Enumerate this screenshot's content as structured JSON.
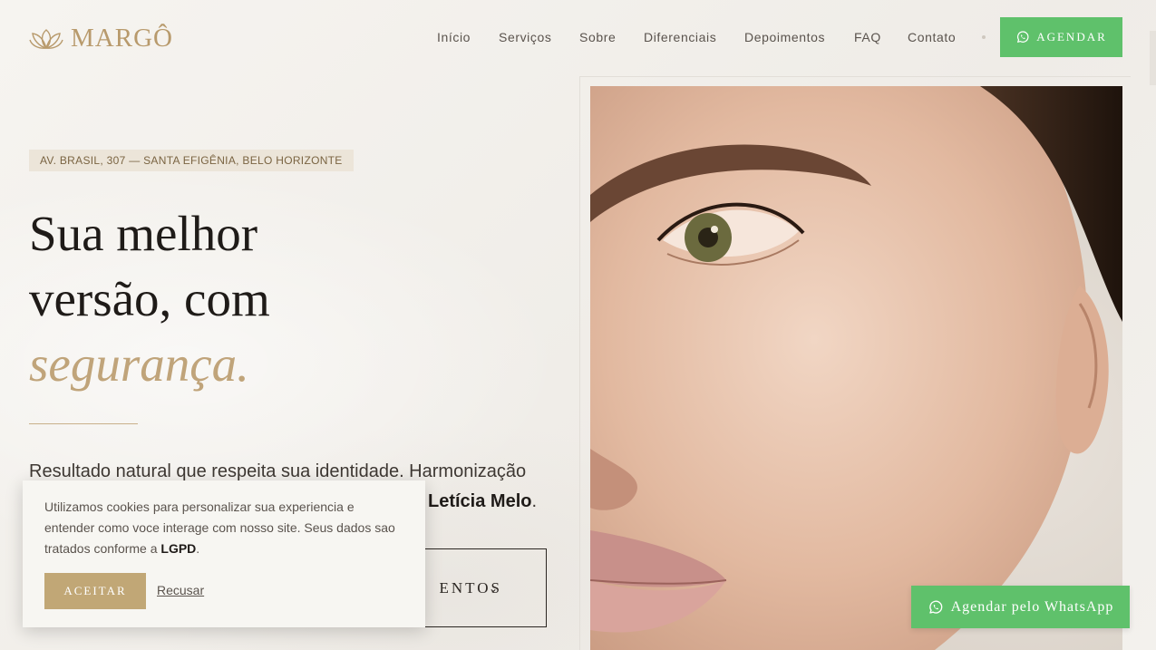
{
  "brand": {
    "name": "MARGÔ",
    "accent": "#b89a6c"
  },
  "nav": {
    "items": [
      "Início",
      "Serviços",
      "Sobre",
      "Diferenciais",
      "Depoimentos",
      "FAQ",
      "Contato"
    ],
    "cta_label": "AGENDAR"
  },
  "hero": {
    "address": "AV. BRASIL, 307 — SANTA EFIGÊNIA, BELO HORIZONTE",
    "headline_line1": "Sua melhor",
    "headline_line2": "versão, com",
    "headline_accent": "segurança.",
    "description_visible": "Resultado natural que respeita sua identidade. Harmonização",
    "description_name": "Letícia Melo",
    "secondary_button_visible": "ENTOS"
  },
  "cookie": {
    "text": "Utilizamos cookies para personalizar sua experiencia e entender como voce interage com nosso site. Seus dados sao tratados conforme a ",
    "text_strong": "LGPD",
    "text_end": ".",
    "accept_label": "ACEITAR",
    "decline_label": "Recusar"
  },
  "whatsapp_float": {
    "label": "Agendar pelo WhatsApp"
  },
  "colors": {
    "green": "#5fc16b",
    "gold": "#c1a776",
    "dark": "#1f1b18"
  },
  "icons": [
    "lotus-logo-icon",
    "whatsapp-icon",
    "chevron-down-icon"
  ]
}
